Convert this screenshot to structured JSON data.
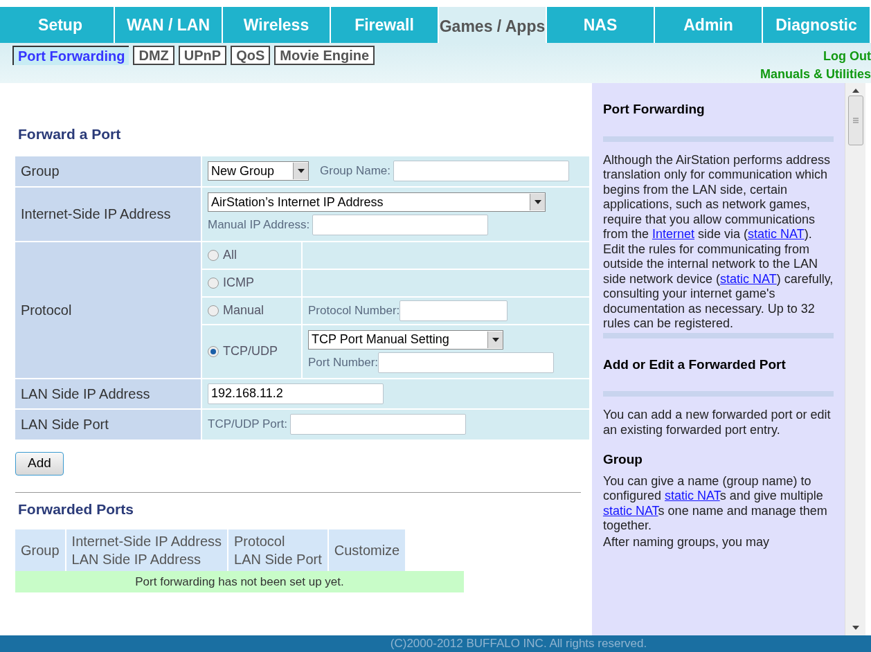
{
  "top_tabs": [
    {
      "label": "Setup",
      "selected": false
    },
    {
      "label": "WAN / LAN",
      "selected": false
    },
    {
      "label": "Wireless",
      "selected": false
    },
    {
      "label": "Firewall",
      "selected": false
    },
    {
      "label": "Games / Apps",
      "selected": true
    },
    {
      "label": "NAS",
      "selected": false
    },
    {
      "label": "Admin",
      "selected": false
    },
    {
      "label": "Diagnostic",
      "selected": false
    }
  ],
  "sub_tabs": [
    {
      "label": "Port Forwarding",
      "selected": true
    },
    {
      "label": "DMZ",
      "selected": false
    },
    {
      "label": "UPnP",
      "selected": false
    },
    {
      "label": "QoS",
      "selected": false
    },
    {
      "label": "Movie Engine",
      "selected": false
    }
  ],
  "header_links": [
    "Log Out",
    "Manuals & Utilities"
  ],
  "form": {
    "title": "Forward a Port",
    "group": {
      "label": "Group",
      "select": "New Group",
      "name_label": "Group Name:"
    },
    "internet_ip": {
      "label": "Internet-Side IP Address",
      "select": "AirStation’s Internet IP Address",
      "manual_label": "Manual IP Address:"
    },
    "protocol": {
      "label": "Protocol",
      "options": [
        {
          "label": "All",
          "selected": false,
          "kind": "plain"
        },
        {
          "label": "ICMP",
          "selected": false,
          "kind": "plain"
        },
        {
          "label": "Manual",
          "selected": false,
          "kind": "number",
          "field_label": "Protocol Number:"
        },
        {
          "label": "TCP/UDP",
          "selected": true,
          "kind": "ports",
          "select": "TCP Port Manual Setting",
          "field_label": "Port Number:"
        }
      ]
    },
    "lan_ip": {
      "label": "LAN Side IP Address",
      "value": "192.168.11.2"
    },
    "lan_port": {
      "label": "LAN Side Port",
      "field_label": "TCP/UDP Port:"
    },
    "add_button": "Add"
  },
  "forwarded": {
    "title": "Forwarded Ports",
    "columns": [
      [
        "Group"
      ],
      [
        "Internet-Side IP Address",
        "LAN Side IP Address"
      ],
      [
        "Protocol",
        "LAN Side Port"
      ],
      [
        "Customize"
      ]
    ],
    "empty_message": "Port forwarding has not been set up yet."
  },
  "help": {
    "blocks": [
      {
        "kind": "heading",
        "text": "Port Forwarding"
      },
      {
        "kind": "rule"
      },
      {
        "kind": "paragraph",
        "segments": [
          {
            "text": "Although the AirStation performs address translation only for communication which begins from the LAN side, certain applications, such as network games, require that you allow communications from the "
          },
          {
            "link": "Internet"
          },
          {
            "text": " side via ("
          },
          {
            "link": "static NAT"
          },
          {
            "text": "). Edit the rules for communicating from outside the internal network to the LAN side network device ("
          },
          {
            "link": "static NAT"
          },
          {
            "text": ") carefully, consulting your internet game's documentation as necessary. Up to 32 rules can be registered."
          }
        ]
      },
      {
        "kind": "rule"
      },
      {
        "kind": "heading",
        "text": "Add or Edit a Forwarded Port"
      },
      {
        "kind": "rule"
      },
      {
        "kind": "paragraph",
        "segments": [
          {
            "text": "You can add a new forwarded port or edit an existing forwarded port entry."
          }
        ]
      },
      {
        "kind": "subheading",
        "text": "Group"
      },
      {
        "kind": "paragraph",
        "segments": [
          {
            "text": "You can give a name (group name) to configured "
          },
          {
            "link": "static NAT"
          },
          {
            "text": "s and give multiple "
          },
          {
            "link": "static NAT"
          },
          {
            "text": "s one name and manage them together."
          }
        ]
      },
      {
        "kind": "paragraph",
        "segments": [
          {
            "text": "After naming groups, you may"
          }
        ]
      }
    ]
  },
  "footer": "(C)2000-2012 BUFFALO INC. All rights reserved."
}
